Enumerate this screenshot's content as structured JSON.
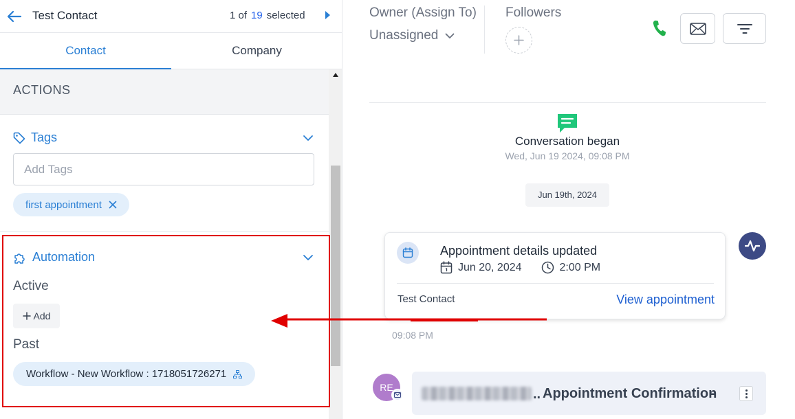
{
  "header": {
    "contact_name": "Test Contact",
    "nav_prefix": "1 of",
    "nav_total": "19",
    "nav_suffix": "selected"
  },
  "tabs": [
    {
      "label": "Contact",
      "active": true
    },
    {
      "label": "Company",
      "active": false
    }
  ],
  "actions": {
    "heading": "ACTIONS"
  },
  "tags": {
    "title": "Tags",
    "input_placeholder": "Add Tags",
    "chips": [
      "first appointment"
    ]
  },
  "automation": {
    "title": "Automation",
    "active_label": "Active",
    "add_label": "Add",
    "past_label": "Past",
    "past_workflows": [
      "Workflow - New Workflow : 1718051726271"
    ]
  },
  "owner": {
    "label": "Owner (Assign To)",
    "value": "Unassigned"
  },
  "followers": {
    "label": "Followers"
  },
  "conversation": {
    "began_title": "Conversation began",
    "began_date": "Wed, Jun 19 2024, 09:08 PM",
    "date_pill": "Jun 19th, 2024"
  },
  "appointment": {
    "title": "Appointment details updated",
    "date": "Jun 20, 2024",
    "time": "2:00 PM",
    "contact": "Test Contact",
    "link": "View appointment",
    "timestamp": "09:08 PM"
  },
  "email": {
    "avatar_initials": "RE",
    "ellipsis": "..",
    "subject": "Appointment Confirmation",
    "dash": "-"
  },
  "colors": {
    "accent": "#2a7fd4",
    "link": "#1d5fd1",
    "annotation_red": "#e00000",
    "phone_green": "#22b14c",
    "conversation_green": "#1fc77a",
    "activity_navy": "#3d4a85",
    "avatar_purple": "#b07ccc"
  }
}
